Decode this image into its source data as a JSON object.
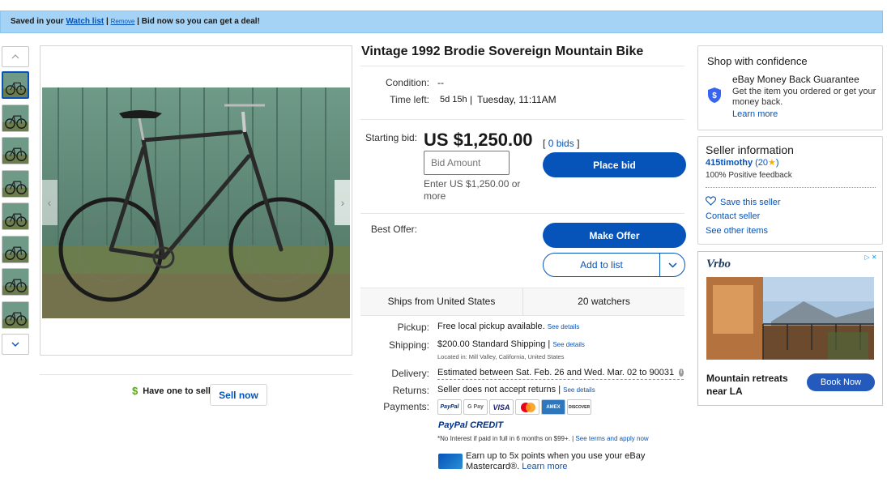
{
  "notice": {
    "prefix": "Saved in your",
    "watch_link": "Watch list",
    "sep1": "|",
    "remove": "Remove",
    "suffix": "| Bid now so you can get a deal!"
  },
  "gallery": {
    "thumbnail_count": 8,
    "selected_index": 0
  },
  "sell": {
    "prompt": "Have one to sell?",
    "button": "Sell now"
  },
  "listing": {
    "title": "Vintage 1992 Brodie Sovereign Mountain Bike",
    "condition_label": "Condition:",
    "condition_value": "--",
    "time_left_label": "Time left:",
    "time_left_value": "5d 15h",
    "time_sep": "|",
    "end_time": "Tuesday, 11:11AM",
    "starting_bid_label": "Starting bid:",
    "price": "US $1,250.00",
    "bids_open": "[",
    "bids_link": "0 bids",
    "bids_close": "]",
    "bid_placeholder": "Bid Amount",
    "bid_hint": "Enter US $1,250.00 or more",
    "place_bid": "Place bid",
    "best_offer_label": "Best Offer:",
    "make_offer": "Make Offer",
    "add_to_list": "Add to list",
    "ships_from": "Ships from United States",
    "watchers": "20 watchers",
    "pickup_label": "Pickup:",
    "pickup_value": "Free local pickup available.",
    "see_details": "See details",
    "shipping_label": "Shipping:",
    "shipping_price": "$200.00",
    "shipping_type": "Standard Shipping |",
    "located": "Located in:  Mill Valley, California, United States",
    "delivery_label": "Delivery:",
    "delivery_value": "Estimated between Sat. Feb. 26 and Wed. Mar. 02 to 90031",
    "returns_label": "Returns:",
    "returns_value": "Seller does not accept returns |",
    "payments_label": "Payments:",
    "payment_methods": [
      "PayPal",
      "G Pay",
      "VISA",
      "MC",
      "AMEX",
      "DISCOVER"
    ],
    "paypal_credit": "PayPal CREDIT",
    "credit_note": "*No Interest if paid in full in 6 months on $99+. |",
    "credit_link": "See terms and apply now",
    "mastercard_text": "Earn up to 5x points when you use your eBay Mastercard®.",
    "learn_more": "Learn more"
  },
  "confidence": {
    "title": "Shop with confidence",
    "guarantee_title": "eBay Money Back Guarantee",
    "guarantee_text": "Get the item you ordered or get your money back.",
    "learn_more": "Learn more"
  },
  "seller": {
    "title": "Seller information",
    "name": "415timothy",
    "score_open": "(20",
    "score_close": ")",
    "feedback": "100% Positive feedback",
    "save": "Save this seller",
    "contact": "Contact seller",
    "other_items": "See other items"
  },
  "ad": {
    "brand": "Vrbo",
    "headline": "Mountain retreats near LA",
    "cta": "Book Now"
  },
  "colors": {
    "link": "#0654ba",
    "notice_bg": "#a4d3f5",
    "primary_button": "#0654ba",
    "star": "#f5af02"
  }
}
